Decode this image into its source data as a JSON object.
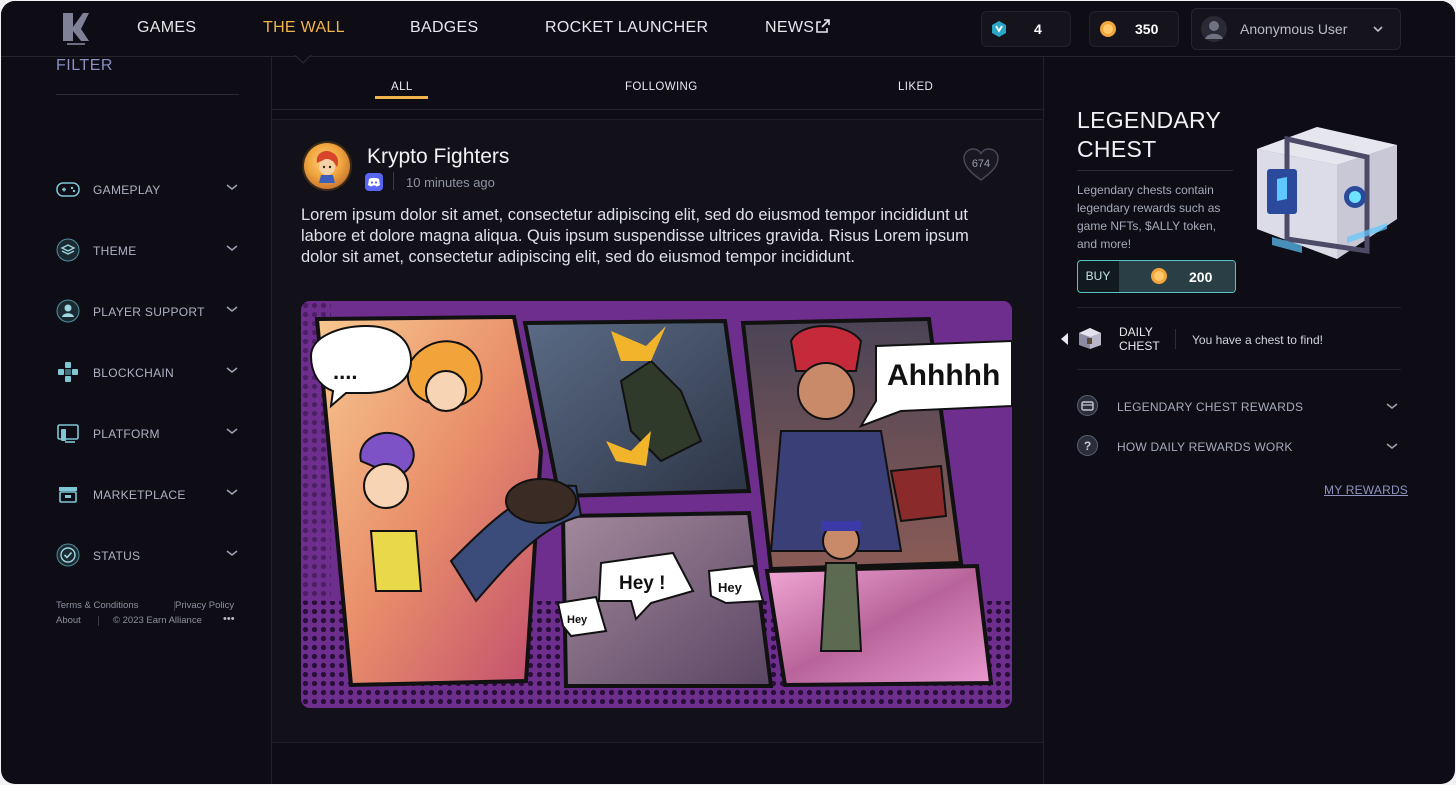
{
  "nav": {
    "links": [
      "GAMES",
      "THE WALL",
      "BADGES",
      "ROCKET LAUNCHER",
      "NEWS"
    ],
    "active": "THE WALL",
    "badge_count": "4",
    "coin_count": "350",
    "user_name": "Anonymous User",
    "colors": {
      "accent": "#f0b44a",
      "background": "#0e0d15"
    }
  },
  "sidebar": {
    "title": "FILTER",
    "items": [
      {
        "label": "GAMEPLAY",
        "icon": "gamepad-icon"
      },
      {
        "label": "THEME",
        "icon": "layers-icon"
      },
      {
        "label": "PLAYER SUPPORT",
        "icon": "user-support-icon"
      },
      {
        "label": "BLOCKCHAIN",
        "icon": "blockchain-icon"
      },
      {
        "label": "PLATFORM",
        "icon": "platform-icon"
      },
      {
        "label": "MARKETPLACE",
        "icon": "store-icon"
      },
      {
        "label": "STATUS",
        "icon": "check-circle-icon"
      }
    ],
    "footer": {
      "terms": "Terms & Conditions",
      "privacy": "Privacy Policy",
      "about": "About",
      "copyright": "© 2023 Earn Alliance",
      "more": "•••"
    }
  },
  "feed": {
    "tabs": [
      "ALL",
      "FOLLOWING",
      "LIKED"
    ],
    "active_tab": "ALL",
    "post": {
      "author": "Krypto Fighters",
      "time": "10 minutes ago",
      "likes": "674",
      "body": "Lorem ipsum dolor sit amet, consectetur adipiscing elit, sed do eiusmod tempor incididunt ut labore et dolore magna aliqua. Quis ipsum suspendisse ultrices gravida. Risus Lorem ipsum dolor sit amet, consectetur adipiscing elit, sed do eiusmod tempor incididunt.",
      "image": {
        "bubbles": [
          "....",
          "Ahhhhh",
          "Hey !",
          "Hey",
          "Hey"
        ]
      }
    }
  },
  "right": {
    "chest_title_1": "LEGENDARY",
    "chest_title_2": "CHEST",
    "chest_desc": "Legendary chests contain legendary rewards such as game NFTs, $ALLY token, and more!",
    "buy_label": "BUY",
    "price": "200",
    "daily_label_1": "DAILY",
    "daily_label_2": "CHEST",
    "daily_message": "You have a chest to find!",
    "accordion": [
      {
        "label": "LEGENDARY CHEST REWARDS",
        "icon": "chest-rewards-icon"
      },
      {
        "label": "HOW DAILY REWARDS WORK",
        "icon": "question-icon"
      }
    ],
    "my_rewards": "MY REWARDS"
  }
}
